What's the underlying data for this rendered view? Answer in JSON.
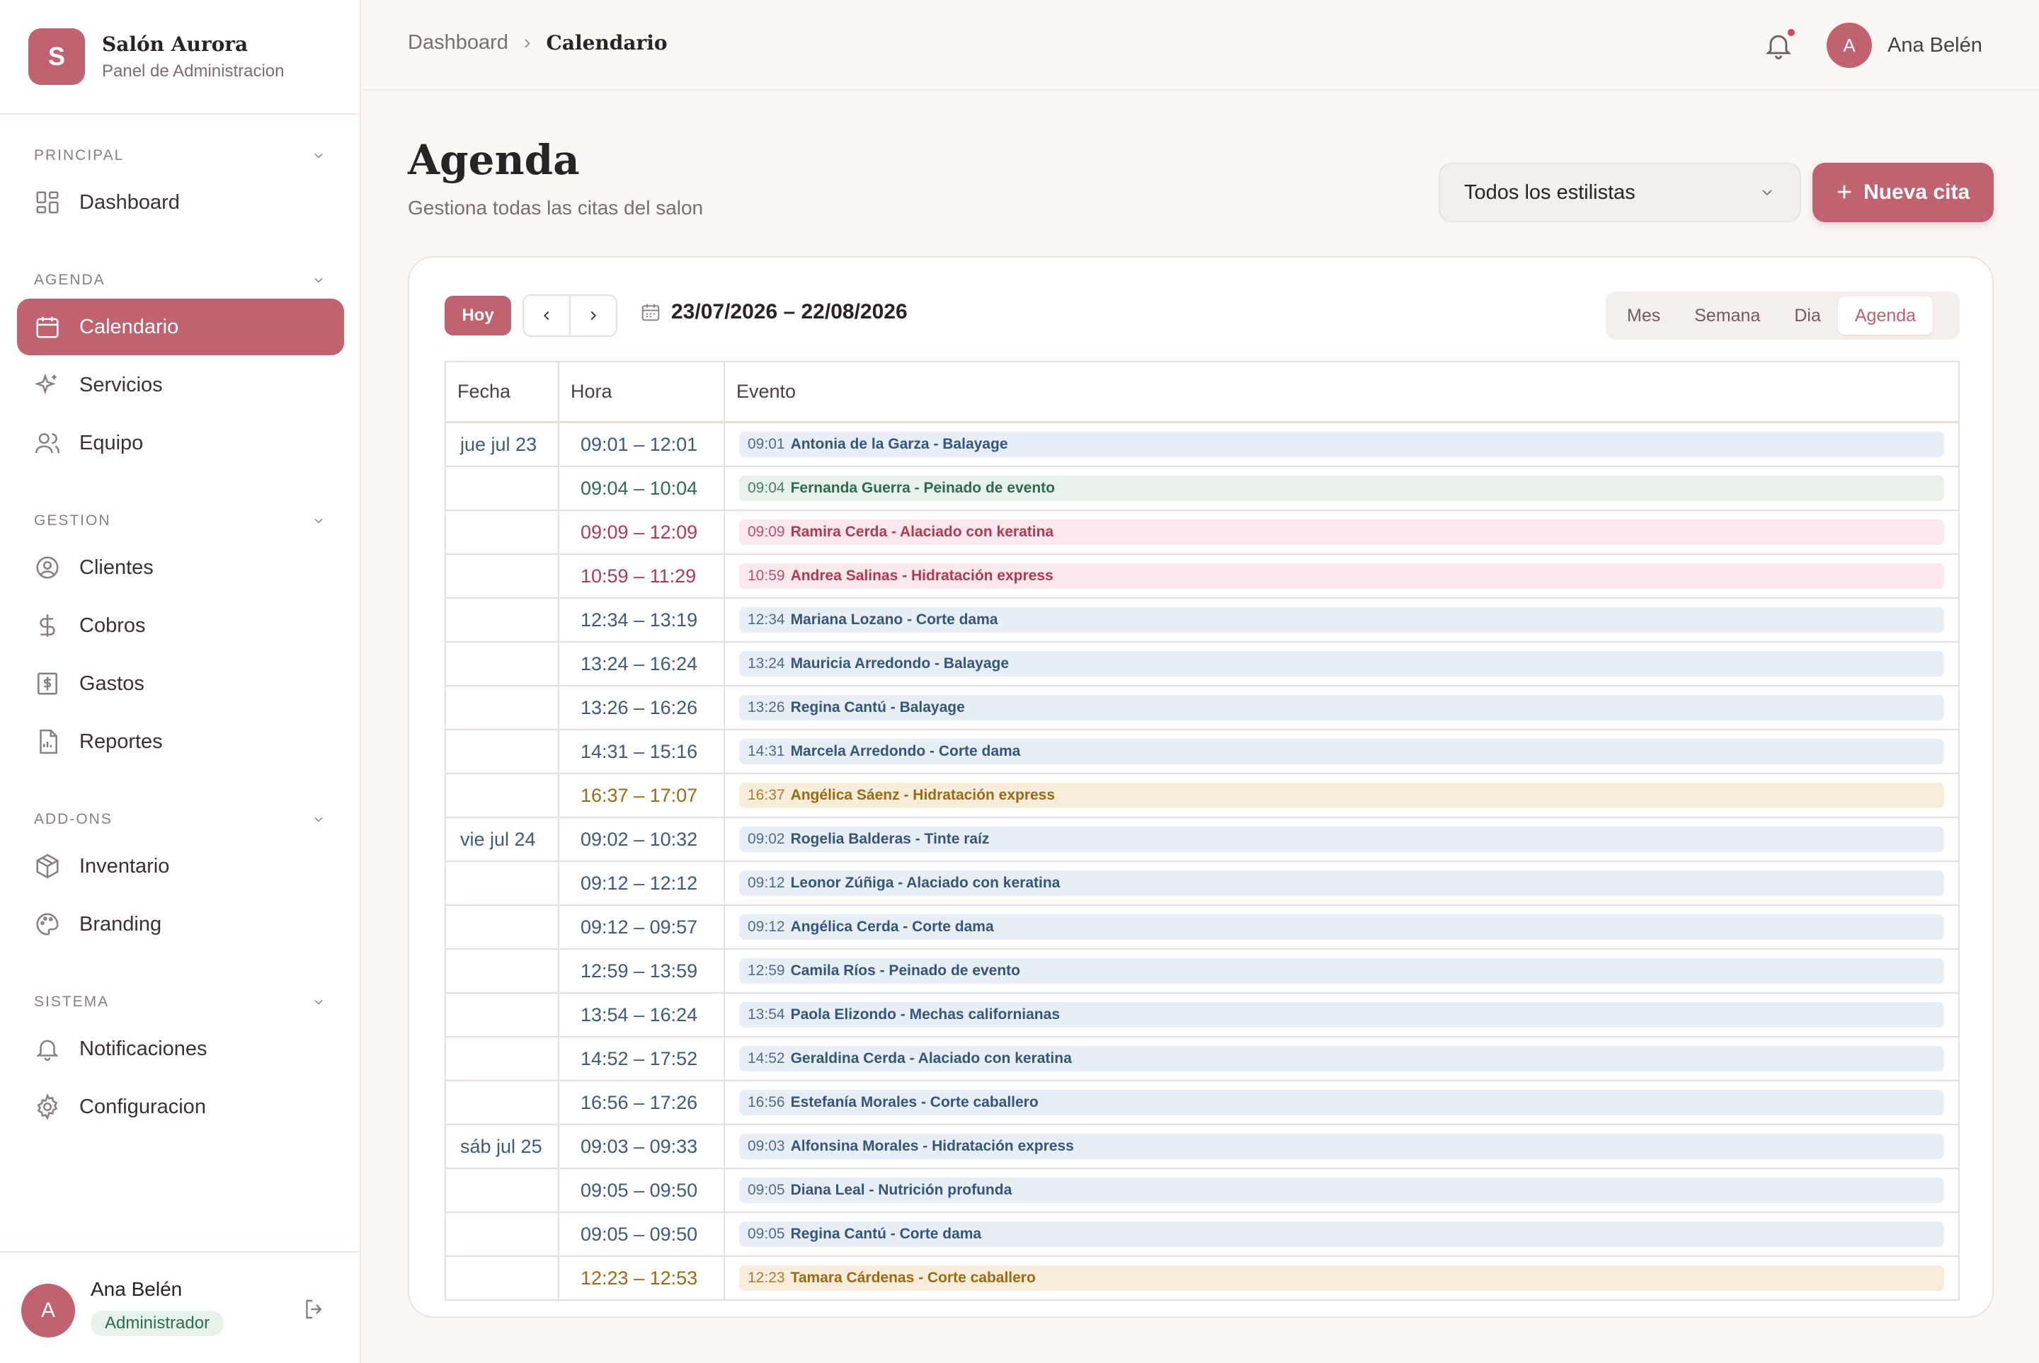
{
  "brand": {
    "logo_letter": "S",
    "name": "Salón Aurora",
    "subtitle": "Panel de Administracion"
  },
  "sidebar": {
    "sections": [
      {
        "title": "PRINCIPAL",
        "items": [
          {
            "label": "Dashboard",
            "icon": "grid-icon"
          }
        ]
      },
      {
        "title": "AGENDA",
        "items": [
          {
            "label": "Calendario",
            "icon": "calendar-icon",
            "active": true
          },
          {
            "label": "Servicios",
            "icon": "sparkles-icon"
          },
          {
            "label": "Equipo",
            "icon": "users-icon"
          }
        ]
      },
      {
        "title": "GESTION",
        "items": [
          {
            "label": "Clientes",
            "icon": "user-circle-icon"
          },
          {
            "label": "Cobros",
            "icon": "dollar-icon"
          },
          {
            "label": "Gastos",
            "icon": "receipt-icon"
          },
          {
            "label": "Reportes",
            "icon": "report-icon"
          }
        ]
      },
      {
        "title": "ADD-ONS",
        "items": [
          {
            "label": "Inventario",
            "icon": "box-icon"
          },
          {
            "label": "Branding",
            "icon": "palette-icon"
          }
        ]
      },
      {
        "title": "SISTEMA",
        "items": [
          {
            "label": "Notificaciones",
            "icon": "bell-icon"
          },
          {
            "label": "Configuracion",
            "icon": "gear-icon"
          }
        ]
      }
    ],
    "user": {
      "initial": "A",
      "name": "Ana Belén",
      "role": "Administrador"
    }
  },
  "topbar": {
    "breadcrumb": [
      "Dashboard",
      "Calendario"
    ],
    "user_initial": "A",
    "user_name": "Ana Belén"
  },
  "page": {
    "title": "Agenda",
    "subtitle": "Gestiona todas las citas del salon"
  },
  "filter": {
    "selected": "Todos los estilistas"
  },
  "new_button": {
    "label": "Nueva cita"
  },
  "calendar": {
    "today_label": "Hoy",
    "range": "23/07/2026 – 22/08/2026",
    "views": [
      "Mes",
      "Semana",
      "Dia",
      "Agenda"
    ],
    "active_view": "Agenda",
    "columns": [
      "Fecha",
      "Hora",
      "Evento"
    ],
    "rows": [
      {
        "date": "jue jul 23",
        "time": "09:01 – 12:01",
        "start": "09:01",
        "event": "Antonia de la Garza - Balayage",
        "color": "blue"
      },
      {
        "date": "",
        "time": "09:04 – 10:04",
        "start": "09:04",
        "event": "Fernanda Guerra - Peinado de evento",
        "color": "green"
      },
      {
        "date": "",
        "time": "09:09 – 12:09",
        "start": "09:09",
        "event": "Ramira Cerda - Alaciado con keratina",
        "color": "pink"
      },
      {
        "date": "",
        "time": "10:59 – 11:29",
        "start": "10:59",
        "event": "Andrea Salinas - Hidratación express",
        "color": "pink"
      },
      {
        "date": "",
        "time": "12:34 – 13:19",
        "start": "12:34",
        "event": "Mariana Lozano - Corte dama",
        "color": "blue"
      },
      {
        "date": "",
        "time": "13:24 – 16:24",
        "start": "13:24",
        "event": "Mauricia Arredondo - Balayage",
        "color": "blue"
      },
      {
        "date": "",
        "time": "13:26 – 16:26",
        "start": "13:26",
        "event": "Regina Cantú - Balayage",
        "color": "blue"
      },
      {
        "date": "",
        "time": "14:31 – 15:16",
        "start": "14:31",
        "event": "Marcela Arredondo - Corte dama",
        "color": "blue"
      },
      {
        "date": "",
        "time": "16:37 – 17:07",
        "start": "16:37",
        "event": "Angélica Sáenz - Hidratación express",
        "color": "amber"
      },
      {
        "date": "vie jul 24",
        "time": "09:02 – 10:32",
        "start": "09:02",
        "event": "Rogelia Balderas - Tinte raíz",
        "color": "blue"
      },
      {
        "date": "",
        "time": "09:12 – 12:12",
        "start": "09:12",
        "event": "Leonor Zúñiga - Alaciado con keratina",
        "color": "blue"
      },
      {
        "date": "",
        "time": "09:12 – 09:57",
        "start": "09:12",
        "event": "Angélica Cerda - Corte dama",
        "color": "blue"
      },
      {
        "date": "",
        "time": "12:59 – 13:59",
        "start": "12:59",
        "event": "Camila Ríos - Peinado de evento",
        "color": "blue"
      },
      {
        "date": "",
        "time": "13:54 – 16:24",
        "start": "13:54",
        "event": "Paola Elizondo - Mechas californianas",
        "color": "blue"
      },
      {
        "date": "",
        "time": "14:52 – 17:52",
        "start": "14:52",
        "event": "Geraldina Cerda - Alaciado con keratina",
        "color": "blue"
      },
      {
        "date": "",
        "time": "16:56 – 17:26",
        "start": "16:56",
        "event": "Estefanía Morales - Corte caballero",
        "color": "blue"
      },
      {
        "date": "sáb jul 25",
        "time": "09:03 – 09:33",
        "start": "09:03",
        "event": "Alfonsina Morales - Hidratación express",
        "color": "blue"
      },
      {
        "date": "",
        "time": "09:05 – 09:50",
        "start": "09:05",
        "event": "Diana Leal - Nutrición profunda",
        "color": "blue"
      },
      {
        "date": "",
        "time": "09:05 – 09:50",
        "start": "09:05",
        "event": "Regina Cantú - Corte dama",
        "color": "blue"
      },
      {
        "date": "",
        "time": "12:23 – 12:53",
        "start": "12:23",
        "event": "Tamara Cárdenas - Corte caballero",
        "color": "amber"
      }
    ]
  }
}
